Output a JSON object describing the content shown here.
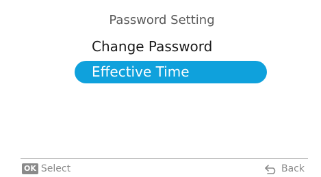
{
  "header": {
    "title": "Password Setting"
  },
  "menu": {
    "items": [
      {
        "label": "Change Password",
        "selected": false
      },
      {
        "label": "Effective Time",
        "selected": true
      }
    ]
  },
  "footer": {
    "ok_badge": "OK",
    "select_label": "Select",
    "back_label": "Back",
    "back_icon": "return-arrow-icon"
  },
  "colors": {
    "accent": "#0fa1dc",
    "text": "#1a1a1a",
    "muted": "#8a8a8a"
  }
}
